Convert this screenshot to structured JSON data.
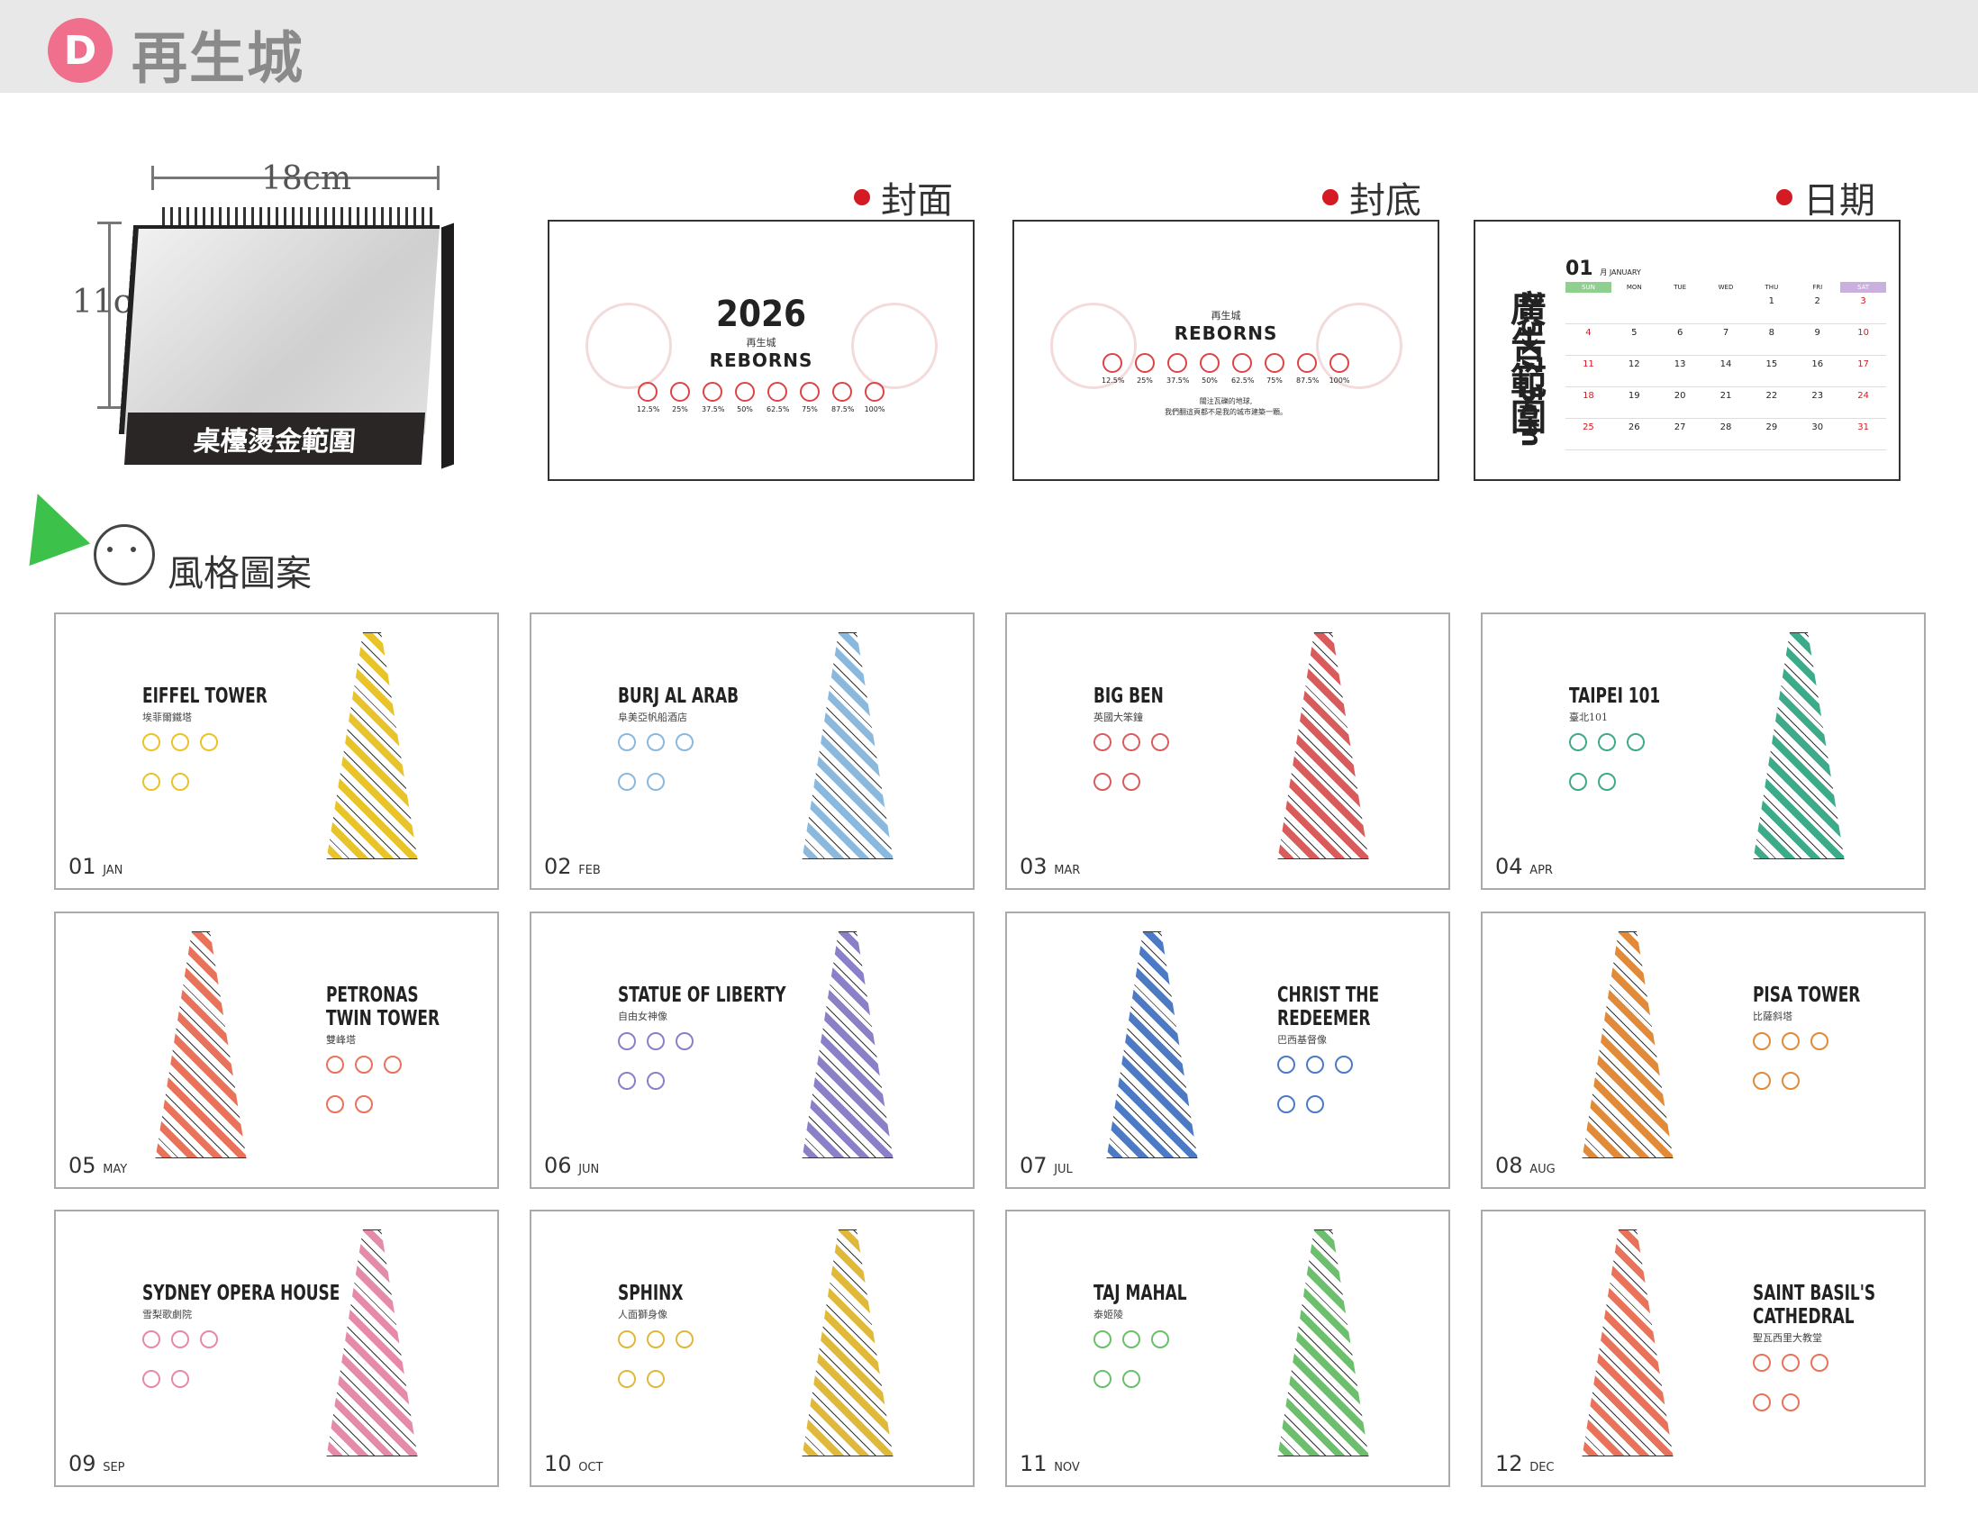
{
  "header": {
    "badge": "D",
    "brand": "再生城"
  },
  "desk": {
    "width_label": "18cm",
    "height_label": "11cm",
    "base_label": "桌檯燙金範圍"
  },
  "pages": [
    {
      "label": "封面"
    },
    {
      "label": "封底"
    },
    {
      "label": "日期"
    }
  ],
  "cover": {
    "year": "2026",
    "zh": "再生城",
    "title": "REBORNS",
    "pcts": [
      "12.5%",
      "25%",
      "37.5%",
      "50%",
      "62.5%",
      "75%",
      "87.5%",
      "100%"
    ]
  },
  "back": {
    "zh": "再生城",
    "title": "REBORNS",
    "pcts": [
      "12.5%",
      "25%",
      "37.5%",
      "50%",
      "62.5%",
      "75%",
      "87.5%",
      "100%"
    ],
    "line1": "關注瓦礫的地球,",
    "line2": "我們翻這頁都不是我的城市建築一顆。"
  },
  "datepage": {
    "ad_label": "廣告範圍",
    "ad_size": "2.5x7.5cm",
    "month_num": "01",
    "month_name": "月 JANUARY",
    "dow": [
      "SUN",
      "MON",
      "TUE",
      "WED",
      "THU",
      "FRI",
      "SAT"
    ],
    "rows": [
      [
        "",
        "",
        "",
        "",
        "1",
        "2",
        "3"
      ],
      [
        "4",
        "5",
        "6",
        "7",
        "8",
        "9",
        "10"
      ],
      [
        "11",
        "12",
        "13",
        "14",
        "15",
        "16",
        "17"
      ],
      [
        "18",
        "19",
        "20",
        "21",
        "22",
        "23",
        "24"
      ],
      [
        "25",
        "26",
        "27",
        "28",
        "29",
        "30",
        "31"
      ]
    ]
  },
  "style_title": "風格圖案",
  "months": [
    {
      "num": "01",
      "abbr": "JAN",
      "name": "EIFFEL TOWER",
      "zh": "埃菲爾鐵塔",
      "color": "#e8c32a"
    },
    {
      "num": "02",
      "abbr": "FEB",
      "name": "BURJ AL ARAB",
      "zh": "阜美亞帆船酒店",
      "color": "#8ab9dd"
    },
    {
      "num": "03",
      "abbr": "MAR",
      "name": "BIG BEN",
      "zh": "英國大笨鐘",
      "color": "#d95c5c"
    },
    {
      "num": "04",
      "abbr": "APR",
      "name": "TAIPEI 101",
      "zh": "臺北101",
      "color": "#3daa8a"
    },
    {
      "num": "05",
      "abbr": "MAY",
      "name": "PETRONAS\nTWIN TOWER",
      "zh": "雙峰塔",
      "color": "#e8735a"
    },
    {
      "num": "06",
      "abbr": "JUN",
      "name": "STATUE OF LIBERTY",
      "zh": "自由女神像",
      "color": "#8a80c8"
    },
    {
      "num": "07",
      "abbr": "JUL",
      "name": "CHRIST THE\nREDEEMER",
      "zh": "巴西基督像",
      "color": "#4c7ac4"
    },
    {
      "num": "08",
      "abbr": "AUG",
      "name": "PISA TOWER",
      "zh": "比薩斜塔",
      "color": "#e08a3a"
    },
    {
      "num": "09",
      "abbr": "SEP",
      "name": "SYDNEY OPERA HOUSE",
      "zh": "雪梨歌劇院",
      "color": "#e58aa8"
    },
    {
      "num": "10",
      "abbr": "OCT",
      "name": "SPHINX",
      "zh": "人面獅身像",
      "color": "#e0b93a"
    },
    {
      "num": "11",
      "abbr": "NOV",
      "name": "TAJ MAHAL",
      "zh": "泰姬陵",
      "color": "#6cbf6c"
    },
    {
      "num": "12",
      "abbr": "DEC",
      "name": "SAINT BASIL'S\nCATHEDRAL",
      "zh": "聖瓦西里大教堂",
      "color": "#e8735a"
    }
  ]
}
